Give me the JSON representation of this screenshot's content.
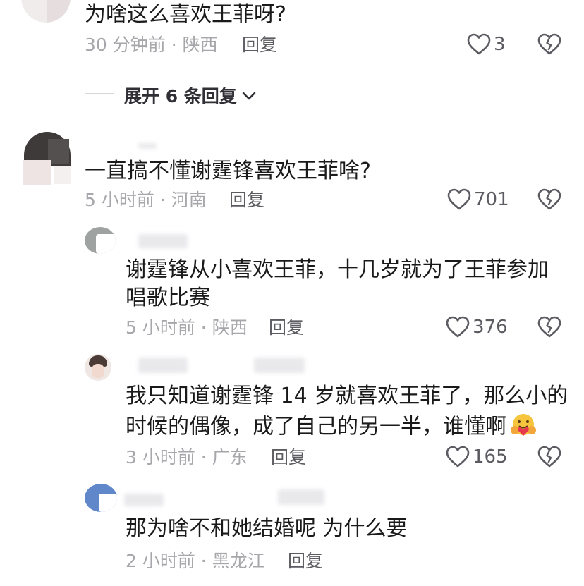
{
  "comments": [
    {
      "text": "为啥这么喜欢王菲呀?",
      "time_location": "30 分钟前 · 陕西",
      "reply_label": "回复",
      "likes": "3",
      "expand_label": "展开 6 条回复"
    },
    {
      "text": "一直搞不懂谢霆锋喜欢王菲啥?",
      "time_location": "5 小时前 · 河南",
      "reply_label": "回复",
      "likes": "701"
    }
  ],
  "replies": [
    {
      "text_line1": "谢霆锋从小喜欢王菲，十几岁就为了王菲参加",
      "text_line2": "唱歌比赛",
      "time_location": "5 小时前 · 陕西",
      "reply_label": "回复",
      "likes": "376"
    },
    {
      "text_line1": "我只知道谢霆锋 14 岁就喜欢王菲了，那么小的",
      "text_line2": "时候的偶像，成了自己的另一半，谁懂啊",
      "time_location": "3 小时前 · 广东",
      "reply_label": "回复",
      "likes": "165",
      "emoji_icon": "hugging-face-emoji"
    },
    {
      "text_line1": "那为啥不和她结婚呢 为什么要",
      "time_location": "2 小时前 · 黑龙江",
      "reply_label": "回复"
    }
  ],
  "icons": {
    "like": "heart-outline-icon",
    "dislike": "broken-heart-icon",
    "expand": "chevron-down-icon"
  },
  "colors": {
    "text": "#1a1a1a",
    "meta": "#a7a7ab",
    "icon": "#5b5b61"
  }
}
